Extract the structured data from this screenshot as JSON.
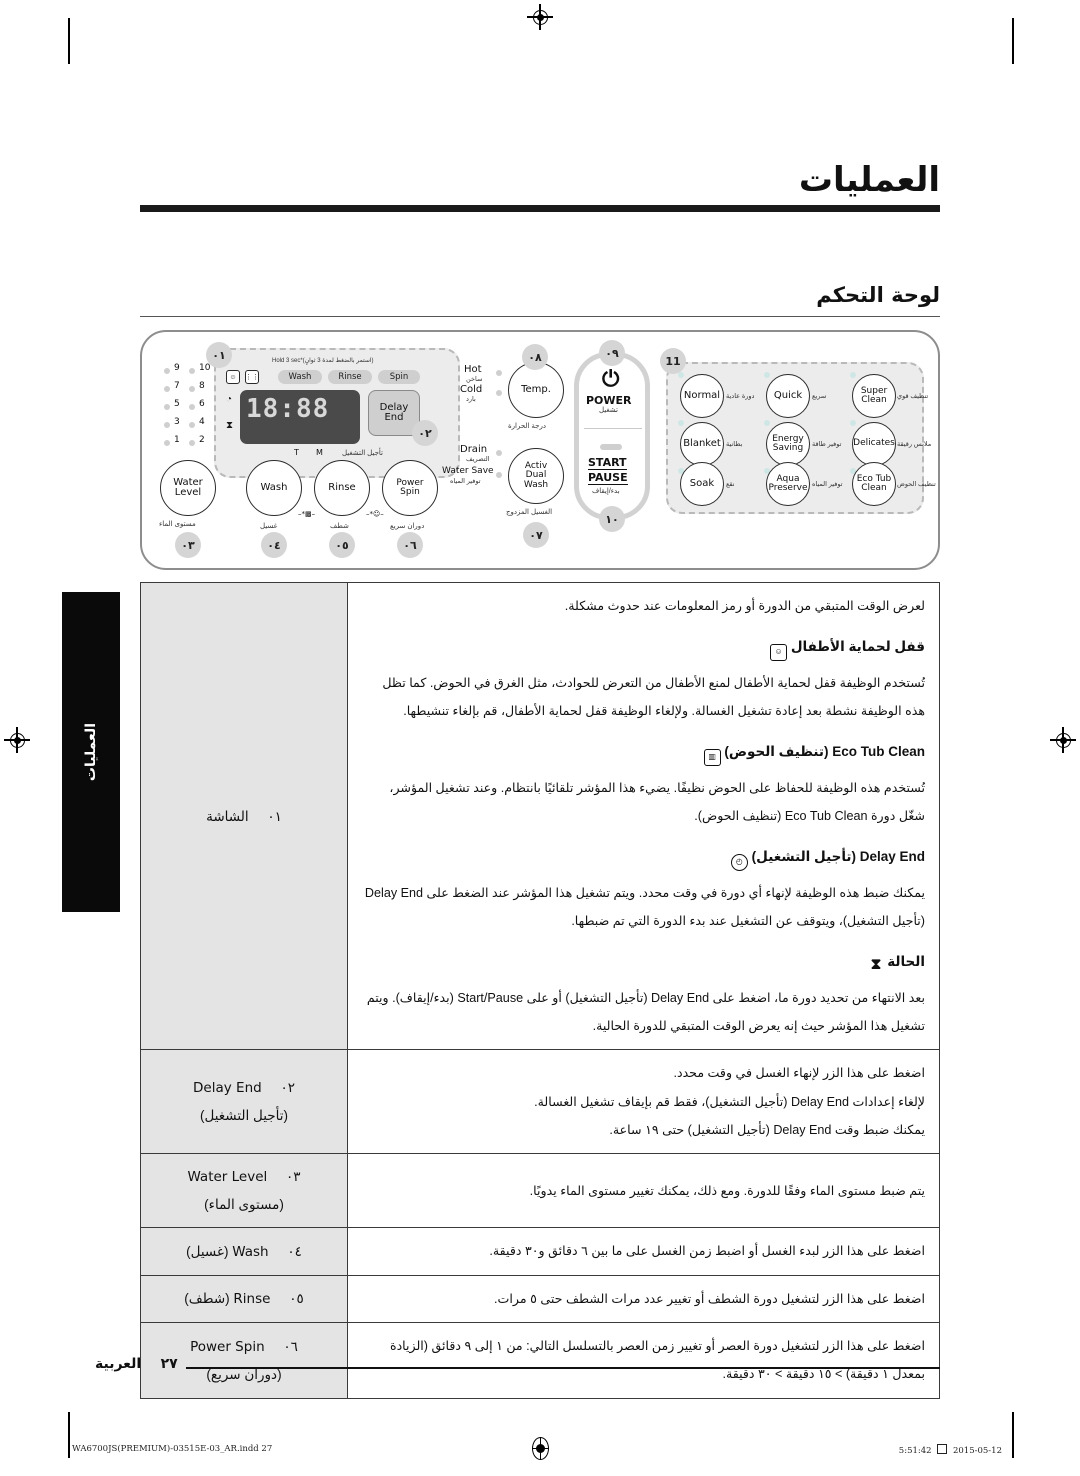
{
  "document": {
    "chapter_title": "العمليات",
    "section_title": "لوحة التحكم",
    "side_tab": "العمليات",
    "page_label": "العربية",
    "page_number": "٢٧"
  },
  "footer": {
    "file": "WA6700JS(PREMIUM)-03515E-03_AR.indd   27",
    "date": "2015-05-12",
    "time": "5:51:42"
  },
  "control_panel": {
    "callouts": {
      "c1": "٠١",
      "c2": "٠٢",
      "c3": "٠٣",
      "c4": "٠٤",
      "c5": "٠٥",
      "c6": "٠٦",
      "c7": "٠٧",
      "c8": "٠٨",
      "c9": "٠٩",
      "c10": "١٠",
      "c11": "11"
    },
    "display": {
      "hold_note": "Hold 3 sec*(استمر بالضغط لمدة 3 ثوانٍ)",
      "pills": [
        "Wash",
        "Rinse",
        "Spin"
      ],
      "segments": "18:88",
      "delay_key_line1": "Delay",
      "delay_key_line2": "End",
      "delay_key_ar": "تأجيل التشغيل",
      "unit_t": "T",
      "unit_m": "M"
    },
    "water_level_indicators": [
      "9",
      "10",
      "7",
      "8",
      "5",
      "6",
      "3",
      "4",
      "1",
      "2"
    ],
    "buttons": [
      {
        "en": "Water Level",
        "ar": "مستوى الماء",
        "callout": "٠٣"
      },
      {
        "en": "Wash",
        "ar": "غسيل",
        "callout": "٠٤"
      },
      {
        "en": "Rinse",
        "ar": "شطف",
        "callout": "٠٥"
      },
      {
        "en": "Power Spin",
        "ar": "دوران سريع",
        "callout": "٠٦"
      },
      {
        "en": "Activ Dual Wash",
        "ar": "الغسيل المزدوج",
        "callout": "٠٧"
      },
      {
        "en": "Temp.",
        "ar": "درجة الحرارة",
        "callout": "٠٨"
      }
    ],
    "temp_indicators": [
      {
        "en": "Hot",
        "ar": "ساخن"
      },
      {
        "en": "Cold",
        "ar": "بارد"
      }
    ],
    "option_indicators": [
      {
        "en": "Drain",
        "ar": "التصريف"
      },
      {
        "en": "Water Save",
        "ar": "توفير المياه"
      }
    ],
    "power": {
      "en": "POWER",
      "ar": "تشغيل",
      "callout": "٠٩"
    },
    "start_pause": {
      "line1": "START",
      "line2": "PAUSE",
      "ar": "بدء/إيقاف",
      "callout": "١٠"
    },
    "cycles": [
      {
        "en": "Normal",
        "ar": "دورة عادية"
      },
      {
        "en": "Quick",
        "ar": "سريع"
      },
      {
        "en": "Super Clean",
        "ar": "تنظيف قوي"
      },
      {
        "en": "Blanket",
        "ar": "بطانية"
      },
      {
        "en": "Energy Saving",
        "ar": "توفير طاقة"
      },
      {
        "en": "Delicates",
        "ar": "ملابس رقيقة"
      },
      {
        "en": "Soak",
        "ar": "نقع"
      },
      {
        "en": "Aqua Preserve",
        "ar": "توفير المياه"
      },
      {
        "en": "Eco Tub Clean",
        "ar": "تنظيف الحوض"
      }
    ]
  },
  "table": {
    "rows": [
      {
        "num": "٠١",
        "label_en": "",
        "label_ar": "الشاشة",
        "paragraphs": [
          "لعرض الوقت المتبقي من الدورة أو رمز المعلومات عند حدوث مشكلة.",
          "قفل لحماية الأطفال",
          "تُستخدم الوظيفة قفل لحماية الأطفال لمنع الأطفال من التعرض للحوادث، مثل الغرق في الحوض. كما تظل هذه الوظيفة نشطة بعد إعادة تشغيل الغسالة. ولإلغاء الوظيفة قفل لحماية الأطفال، قم بإلغاء تنشيطها.",
          "Eco Tub Clean (تنظيف الحوض)",
          "تُستخدم هذه الوظيفة للحفاظ على الحوض نظيفًا. يضيء هذا المؤشر تلقائيًا بانتظام. وعند تشغيل المؤشر، شغّل دورة Eco Tub Clean (تنظيف الحوض).",
          "Delay End (تأجيل التشغيل)",
          "يمكنك ضبط هذه الوظيفة لإنهاء أي دورة في وقت محدد. ويتم تشغيل هذا المؤشر عند الضغط على Delay End (تأجيل التشغيل)، ويتوقف عن التشغيل عند بدء الدورة التي تم ضبطها.",
          "الحالة",
          "بعد الانتهاء من تحديد دورة ما، اضغط على Delay End (تأجيل التشغيل) أو على Start/Pause (بدء/إيقاف). ويتم تشغيل هذا المؤشر حيث إنه يعرض الوقت المتبقي للدورة الحالية."
        ]
      },
      {
        "num": "٠٢",
        "label_en": "Delay End",
        "label_ar": "(تأجيل التشغيل)",
        "paragraphs": [
          "اضغط على هذا الزر لإنهاء الغسل في وقت محدد.",
          "لإلغاء إعدادات Delay End (تأجيل التشغيل)، فقط قم بإيقاف تشغيل الغسالة.",
          "يمكنك ضبط وقت Delay End (تأجيل التشغيل) حتى ١٩ ساعة."
        ]
      },
      {
        "num": "٠٣",
        "label_en": "Water Level",
        "label_ar": "(مستوى الماء)",
        "paragraphs": [
          "يتم ضبط مستوى الماء وفقًا للدورة. ومع ذلك، يمكنك تغيير مستوى الماء يدويًا."
        ]
      },
      {
        "num": "٠٤",
        "label_en": "Wash",
        "label_ar": "(غسيل)",
        "paragraphs": [
          "اضغط على هذا الزر لبدء الغسل أو اضبط زمن الغسل على ما بين ٦ دقائق و٣٠ دقيقة."
        ]
      },
      {
        "num": "٠٥",
        "label_en": "Rinse",
        "label_ar": "(شطف)",
        "paragraphs": [
          "اضغط على هذا الزر لتشغيل دورة الشطف أو تغيير عدد مرات الشطف حتى ٥ مرات."
        ]
      },
      {
        "num": "٠٦",
        "label_en": "Power Spin",
        "label_ar": "(دوران سريع)",
        "paragraphs": [
          "اضغط على هذا الزر لتشغيل دورة العصر أو تغيير زمن العصر بالتسلسل التالي: من ١ إلى ٩ دقائق (الزيادة بمعدل ١ دقيقة) > ١٥ دقيقة > ٣٠ دقيقة."
        ]
      }
    ]
  }
}
